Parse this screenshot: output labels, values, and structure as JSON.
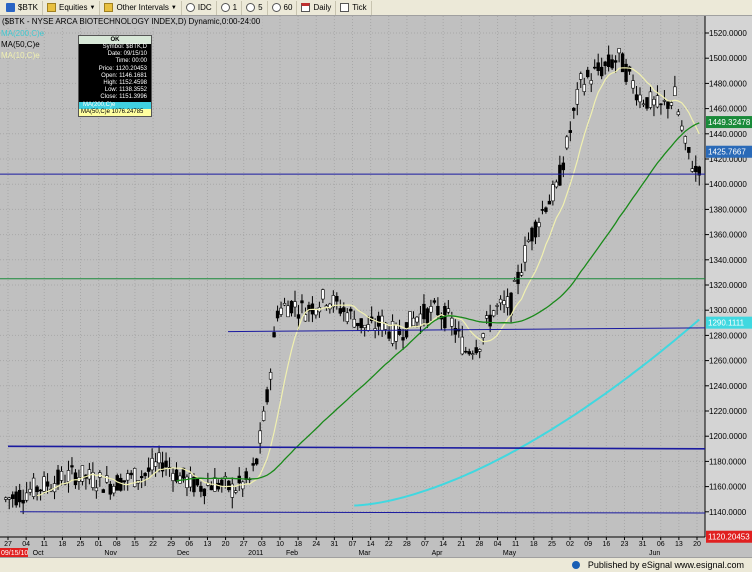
{
  "toolbar": {
    "symbol": "$BTK",
    "equities_menu": "Equities",
    "other_intervals_menu": "Other Intervals",
    "idc": "IDC",
    "interval_1": "1",
    "interval_5": "5",
    "interval_60": "60",
    "daily": "Daily",
    "tick": "Tick"
  },
  "chart": {
    "title": "($BTK - NYSE ARCA BIOTECHNOLOGY INDEX,D) Dynamic,0:00-24:00",
    "legend": [
      "MA(200,C)e",
      "MA(50,C)e",
      "MA(10,C)e"
    ],
    "data_window": {
      "header": "OK",
      "rows": [
        "Symbol: $BTK,D",
        "Date: 09/15/10",
        "Time: 00:00",
        "Price: 1120.20453",
        "Open: 1146.1681",
        "High: 1152.4598",
        "Low: 1138.3552",
        "Close: 1151.3996"
      ],
      "ma200_row": "MA(200,C)e",
      "ma50_row": "MA(50,C)e 1076.24785"
    },
    "price_labels": [
      "1520.0000",
      "1500.0000",
      "1480.0000",
      "1460.0000",
      "1440.0000",
      "1420.0000",
      "1400.0000",
      "1380.0000",
      "1360.0000",
      "1340.0000",
      "1320.0000",
      "1300.0000",
      "1280.0000",
      "1260.0000",
      "1240.0000",
      "1220.0000",
      "1200.0000",
      "1180.0000",
      "1160.0000",
      "1140.0000"
    ],
    "value_tags": [
      {
        "text": "1449.32478",
        "color": "#1a8a3a"
      },
      {
        "text": "1425.7667",
        "color": "#2a6ab8"
      },
      {
        "text": "1120.20453",
        "color": "#e02020"
      },
      {
        "text": "1290.1111",
        "color": "#40d8e0"
      }
    ],
    "date_tag": "09/15/10",
    "day_labels": [
      "27",
      "04",
      "11",
      "18",
      "25",
      "01",
      "08",
      "15",
      "22",
      "29",
      "06",
      "13",
      "20",
      "27",
      "03",
      "10",
      "18",
      "24",
      "31",
      "07",
      "14",
      "22",
      "28",
      "07",
      "14",
      "21",
      "28",
      "04",
      "11",
      "18",
      "25",
      "02",
      "09",
      "16",
      "23",
      "31",
      "06",
      "13",
      "20"
    ],
    "month_labels": [
      "Oct",
      "Nov",
      "Dec",
      "2011",
      "Feb",
      "Mar",
      "Apr",
      "May",
      "Jun"
    ],
    "colors": {
      "background": "#c0c0c0",
      "candle_up": "#ffffff",
      "candle_down": "#000000",
      "ma200": "#40d8e0",
      "ma50": "#1a8a1a",
      "ma10": "#f0f0b0",
      "support": "#1a1aa0",
      "resistance_green": "#1a8a3a"
    }
  },
  "footer": {
    "published_by": "Published by eSignal",
    "url": "www.esignal.com"
  }
}
